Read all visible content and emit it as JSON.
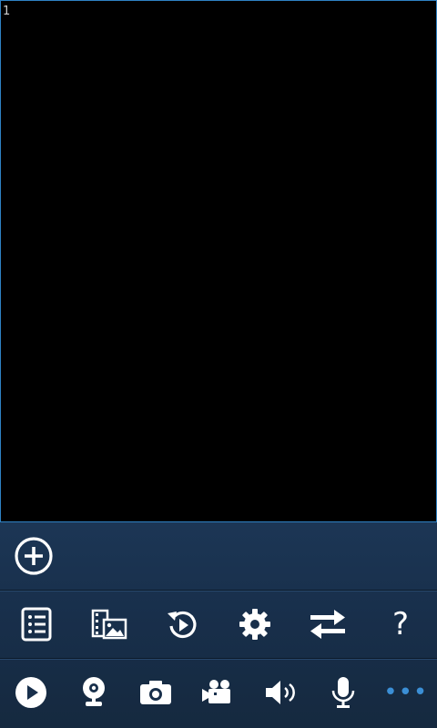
{
  "viewport": {
    "channel_number": "1"
  },
  "toolbar_row1": [
    {
      "name": "list-icon"
    },
    {
      "name": "media-gallery-icon"
    },
    {
      "name": "playback-icon"
    },
    {
      "name": "gear-icon"
    },
    {
      "name": "switch-arrows-icon"
    },
    {
      "name": "help-icon",
      "label": "?"
    }
  ],
  "toolbar_row2": [
    {
      "name": "play-icon"
    },
    {
      "name": "webcam-icon"
    },
    {
      "name": "camera-icon"
    },
    {
      "name": "video-record-icon"
    },
    {
      "name": "speaker-icon"
    },
    {
      "name": "microphone-icon"
    },
    {
      "name": "more-icon",
      "label": "•••"
    }
  ],
  "colors": {
    "accent": "#3b8fd6",
    "panel": "#182f4b",
    "border": "#2f82c4"
  }
}
